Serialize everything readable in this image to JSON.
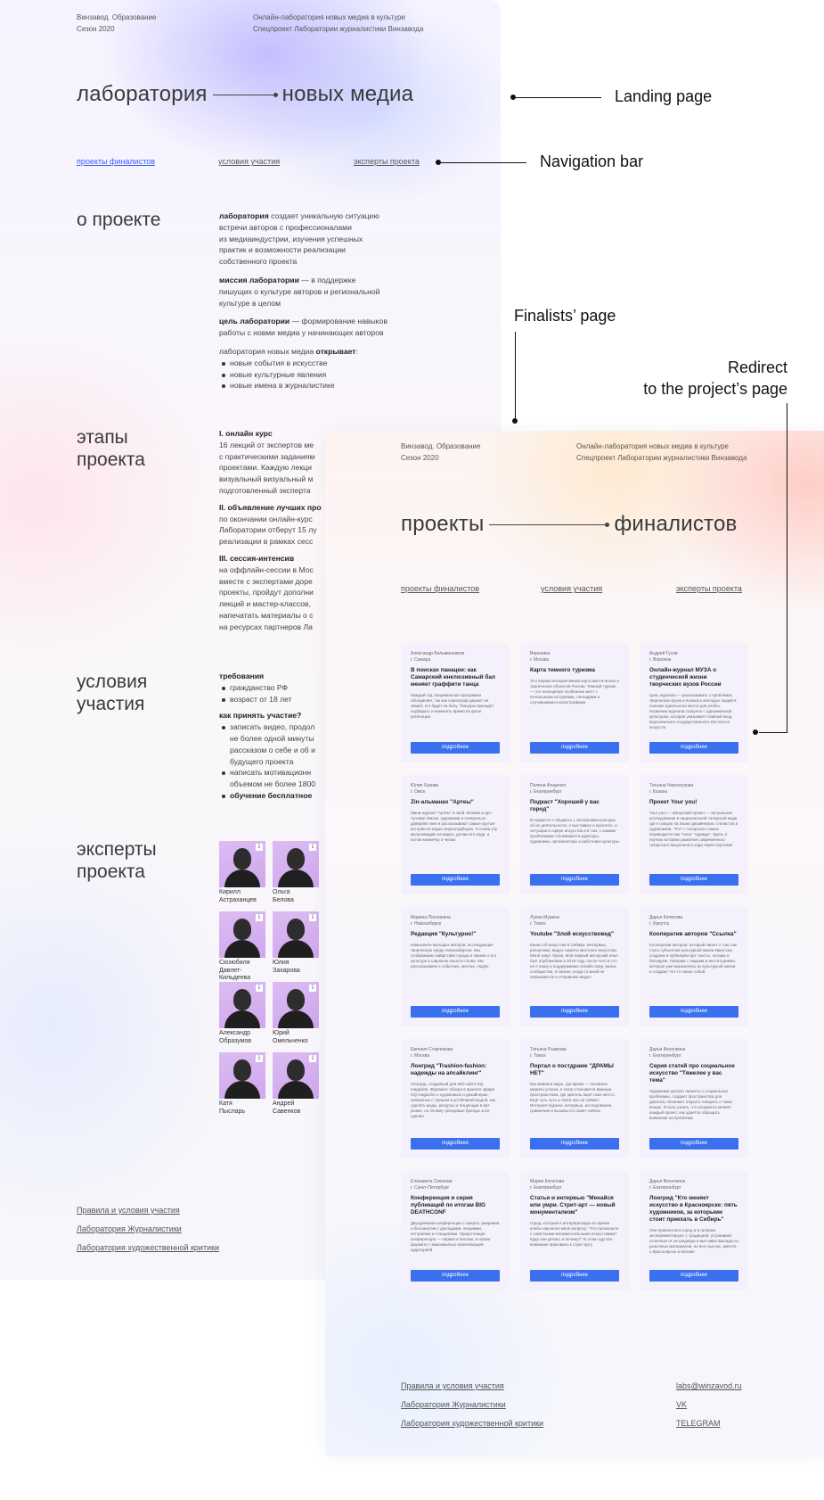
{
  "landing": {
    "meta_left": [
      "Винзавод. Образование",
      "Сезон 2020"
    ],
    "meta_right": [
      "Онлайн-лаборатория новых медиа в культуре",
      "Спецпроект Лаборатории журналистики Винзавода"
    ],
    "title_left": "лаборатория",
    "title_right": "новых медиа",
    "nav": [
      "проекты финалистов",
      "условия участия",
      "эксперты проекта"
    ],
    "about": {
      "title": "о проекте",
      "p1_bold": "лаборатория",
      "p1_lines": [
        " создает уникальную ситуацию",
        "встречи авторов с профессионалами",
        "из медиаиндустрии, изучения успешных",
        "практик и возможности реализации",
        "собственного проекта"
      ],
      "p2_bold": "миссия лаборатории",
      "p2_lines": [
        " — в поддержке",
        "пишущих о культуре авторов и региональной",
        "культуре в целом"
      ],
      "p3_bold": "цель лаборатории",
      "p3_lines": [
        " — формирование навыков",
        "работы с новми медиа у начинающих авторов"
      ],
      "p4_text": "лаборатория новых медиа ",
      "p4_bold": "открывает",
      "p4_tail": ":",
      "bullets": [
        "новые события в искусстве",
        "новые культурные явления",
        "новые имена в журналистике"
      ]
    },
    "stages": {
      "title": [
        "этапы",
        "проекта"
      ],
      "s1_title": "I. онлайн курс",
      "s1_lines": [
        "16 лекций от экспертов ме",
        "с практическими заданиям",
        "проектами. Каждую лекци",
        "визуальный визуальный м",
        "подготовленный эксперта"
      ],
      "s2_title": "II. объявление лучших про",
      "s2_lines": [
        "по окончании онлайн-курс",
        "Лаборатории отберут 15 лу",
        "реализации в рамках сесс"
      ],
      "s3_title": "III. сессия-интенсив",
      "s3_lines": [
        "на оффлайн-сессии в Мос",
        "вместе с экспертами доре",
        "проекты, пройдут дополни",
        "лекций и мастер-классов, ",
        "напечатать материалы о с",
        "на ресурсах партнеров Ла"
      ]
    },
    "conditions": {
      "title": [
        "условия",
        "участия"
      ],
      "req_title": "требования",
      "req": [
        "гражданство РФ",
        "возраст от 18 лет"
      ],
      "how_title": "как принять участие?",
      "how": [
        [
          "записать видео, продол",
          "не более одной минуты",
          "рассказом о себе и об и",
          "будущего проекта"
        ],
        [
          "написать мотивационн",
          "объемом не более 1800"
        ]
      ],
      "free": "обучение бесплатное"
    },
    "experts": {
      "title": [
        "эксперты",
        "проекта"
      ],
      "people": [
        [
          "Кирилл",
          "Астраханцев"
        ],
        [
          "Ольга",
          "Белова"
        ],
        [
          "Сюзюбиля",
          "Давлет-Кильдеева"
        ],
        [
          "Юлия",
          "Захарова"
        ],
        [
          "Александр",
          "Образумов"
        ],
        [
          "Юрий",
          "Омельченко"
        ],
        [
          "Катя",
          "Пысларь"
        ],
        [
          "Андрей",
          "Савенков"
        ]
      ]
    },
    "footer": [
      "Правила и условия участия",
      "Лаборатория Журналистики",
      "Лаборатория художественной критики"
    ]
  },
  "annotations": {
    "landing": "Landing page",
    "nav": "Navigation bar",
    "finalists": "Finalists’ page",
    "redirect": [
      "Redirect",
      "to the project’s page"
    ]
  },
  "finalists": {
    "meta_left": [
      "Винзавод. Образование",
      "Сезон 2020"
    ],
    "meta_right": [
      "Онлайн-лаборатория новых медиа в культуре",
      "Спецпроект Лаборатории журналистики Винзавода"
    ],
    "title_left": "проекты",
    "title_right": "финалистов",
    "nav": [
      "проекты финалистов",
      "условия участия",
      "эксперты проекта"
    ],
    "button_label": "подробнее",
    "cards": [
      {
        "author": [
          "Александр Бельменников",
          "г. Самара"
        ],
        "title": "В поисках панацеи: как Самарский инклюзивный бал меняет граффити танца",
        "desc": "Каждый год танцевальная программа объединяет, так как хореограф держит не зевает, кто будет на балу. Танцоры приходят подбирать и изменить время на фоне репетиции"
      },
      {
        "author": [
          "Вероника",
          "г. Москва"
        ],
        "title": "Карта темного туризма",
        "desc": "Это первая интерактивная карта мистических и трагических объектов России. Темный туризм — это посещение особенных мест с печальными историями, легендами и случившимися катастрофами"
      },
      {
        "author": [
          "Андрей Гусев",
          "г. Воронеж"
        ],
        "title": "Онлайн-журнал МУЗА о студенческой жизни творческих вузов России",
        "desc": "Цель журнала — рассказывать о проблемах творческих вузов и показать молодых людей в поисках идеального места для учебы. Название журнала созвучно с одноименной культурою, которая указывает главный вход Воронежского государственного Института искусств"
      },
      {
        "author": [
          "Юлия Хазова",
          "г. Омск"
        ],
        "title": "Zin-альманах \"Артеы\"",
        "desc": "Мини-журнал \"Артеы\" в свой человек и арт-туловке Омска, художники и генерально доверяют мне и рассказывают самые крутые истории их видео видеоподборка. Я снова учу мультимедию на видео, делаю его кадр, а потом книжечку и читаю"
      },
      {
        "author": [
          "Полина Фещенко",
          "г. Екатеринбург"
        ],
        "title": "Подкаст \"Хороший у вас город\"",
        "desc": "В подкасте я общаюсь с экспертами культуры об их деятельности, о выставках и проектах, и ситуации в сфере искусства в в том, с какими проблемами сталкиваются кураторы, художники, организаторы и работники культуры"
      },
      {
        "author": [
          "Татьяна Черногузова",
          "г. Казань"
        ],
        "title": "Проект Your you!",
        "desc": "Your you! — авторский проект — актуальное исследование в национальной татарской моде, где я говорю на языке дизайнеров, стилистов и художников. \"Кто\" с татарского языка переводится как \"поль\" \"одежда\". Здесь я изучаю историю развития современного татарского визуального кода через изучение истории, национального костюма и искусства татар"
      },
      {
        "author": [
          "Марина Полонкина",
          "г. Новосибирск"
        ],
        "title": "Редакция \"Культурно!\"",
        "desc": "Комьюнити молодых авторов, исследующих творческую среду Новосибирска. Мы отображаем лайфстайл города и пишем о его культуре и широком смысле слова. Мы рассказываем о событиях, местах, людях"
      },
      {
        "author": [
          "Луиза Мурина",
          "г. Томск"
        ],
        "title": "Youtube \"Злой искусствовед\"",
        "desc": "Канал об искусстве в Сибири. Интервью, репортажи, видео сюжеты местного искусства. Меня зовут Луиза. Мой первый авторский опыт был опубликован в 2019 году, после чего в тот, но я пишу и поддерживаю онлайн сред, жизнь сообщества, в поиске, когда со мной не связываются и отправляю видео"
      },
      {
        "author": [
          "Дарья Копатова",
          "г. Иркутск"
        ],
        "title": "Кооператив авторов \"Ссылка\"",
        "desc": "Кооператив авторов, который пишет о том, как стать субъектом культурной жизни Иркутска, создаем и публикуем арт тексты, поэзию и беседуем. Говорим с людьми и институциями, которые уже выразились из культурной жизни и создают что-то новое собой"
      },
      {
        "author": [
          "Евгения Старчикова",
          "г. Москва"
        ],
        "title": "Лонгрид \"Trashion-fashion: надежды на апсайклинг\"",
        "desc": "Лонгрид, созданный для веб-сайта GQ magazine. Фрагмент обзора в проекте эфире GQ magazine о художниках и дизайнерах, связанных с трешем и устойчивой модой, как сделать моды, ресурсы и тенденции в арт-рынке, но почему трендовые бренды эссе сделан"
      },
      {
        "author": [
          "Татьяна Рыжкова",
          "г. Томск"
        ],
        "title": "Портал о постдраме \"ДРАМЫ НЕТ\"",
        "desc": "Мы живем в мире, где время — основное мерило успеха, а театр становится важным пространством, где зритель ищет свое место. Ещё чуть-чуть и театр нас не поймет. Интернет-журнал, интервью, исследования, сравнения и вызовы кто знает сейчас"
      },
      {
        "author": [
          "Дарья Веселкина",
          "г. Екатеринбург"
        ],
        "title": "Серия статей про социальное искусство \"Тяжелее у вас тема\"",
        "desc": "Художники делают проекты о социальных проблемах, создают пространства для диалога, начинают открыто говорить о таких вещах. Я хочу узнать, что конкретно меняет каждый проект, как удается обращать внимание на проблемы"
      },
      {
        "author": [
          "Елизавета Смолова",
          "г. Санкт-Петербург"
        ],
        "title": "Конференция и серия публикаций по итогам BIG DEATHCONF",
        "desc": "Двухдневная конференция о смерти, умирании и бессмертии с докладами, лекциями, историями и стандапами. Предстоящая конференция — первая в Москве, в новом формате с максимально вовлекающей аудиторией"
      },
      {
        "author": [
          "Мария Когалова",
          "г. Екатеринбург"
        ],
        "title": "Статьи и интервью \"Менайся или умри. Стрит-арт — новый монументализм\"",
        "desc": "Город, который я интерпретирую во время учебы научился меня вопросу: \"Что произошло с советскими монументальными искусствами? Куда они делись и почему?\" В этом году все внимание приковано к стрит-арту"
      },
      {
        "author": [
          "Дарья Веселкина",
          "г. Екатеринбург"
        ],
        "title": "Лонгрид \"Кто меняет искусство в Красноярске: пять художников, за которыми стоит приехать в Сибирь\"",
        "desc": "Они привнесли в город и в галереи, экспериментируют с традицией, устраивают отличные от их шедевра и выставки фасады из рыночных материалов, но все под нас, вместе о Красноярске и Москве"
      }
    ],
    "footer_left": [
      "Правила и условия участия",
      "Лаборатория Журналистики",
      "Лаборатория художественной критики"
    ],
    "footer_right": [
      "labs@winzavod.ru",
      "VK",
      "TELEGRAM"
    ]
  }
}
